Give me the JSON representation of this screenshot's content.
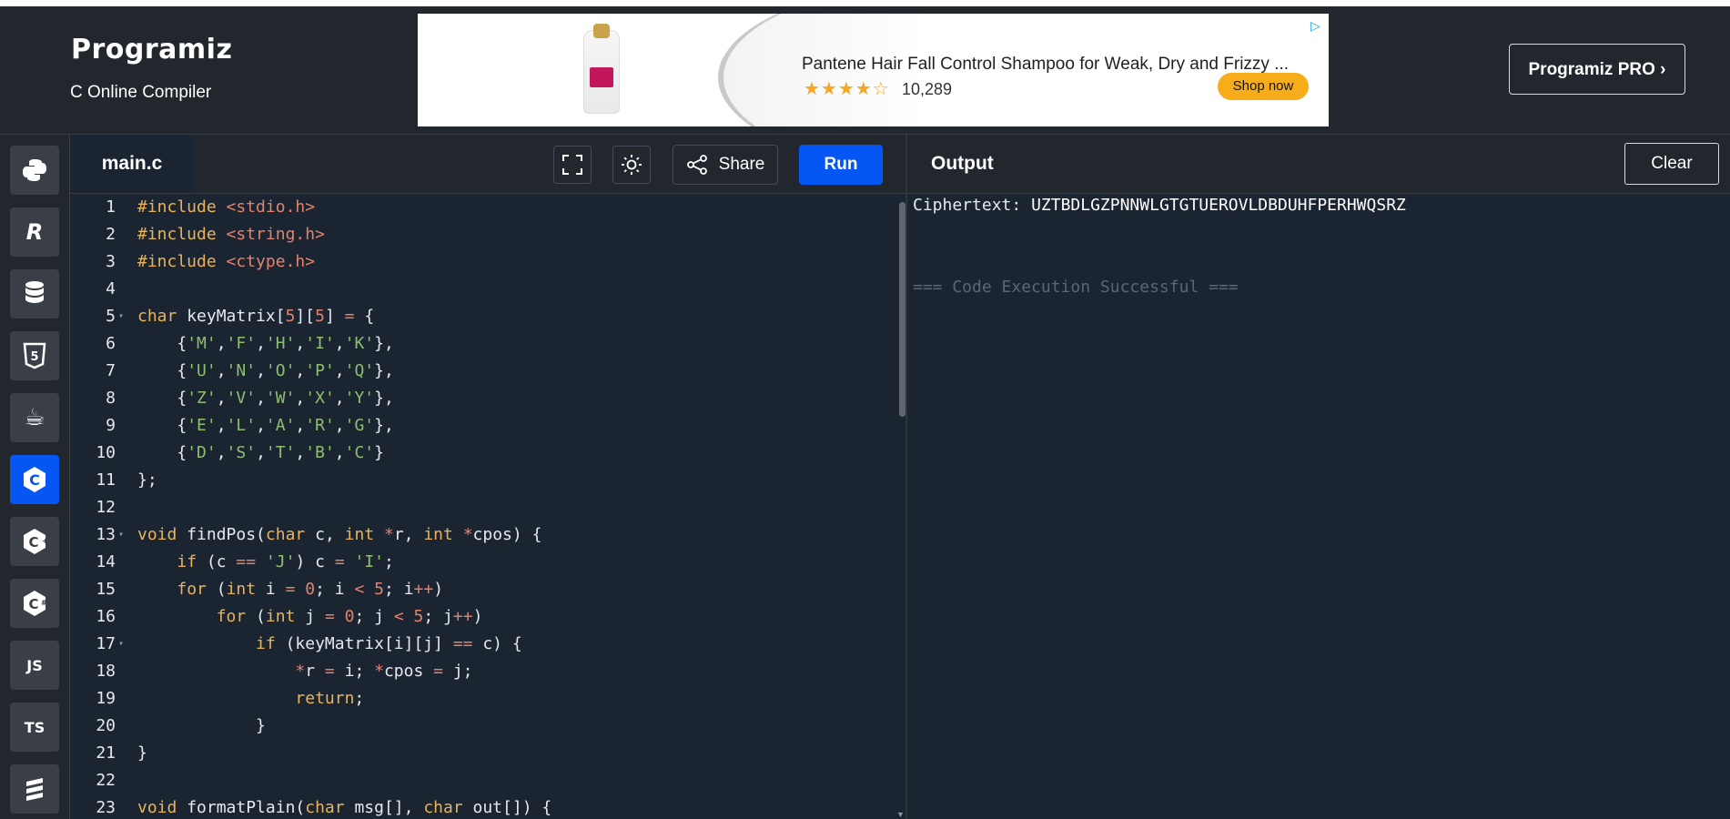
{
  "header": {
    "logo": "Programiz",
    "subtitle": "C Online Compiler",
    "pro_button": "Programiz PRO ›"
  },
  "ad": {
    "title": "Pantene Hair Fall Control Shampoo for Weak, Dry and Frizzy ...",
    "stars": "★★★★☆",
    "rating_count": "10,289",
    "cta": "Shop now"
  },
  "sidebar": {
    "items": [
      {
        "name": "python",
        "glyph": "🐍"
      },
      {
        "name": "r",
        "glyph": "R"
      },
      {
        "name": "sql",
        "glyph": "≡"
      },
      {
        "name": "html",
        "glyph": "5"
      },
      {
        "name": "java",
        "glyph": "☕"
      },
      {
        "name": "c",
        "glyph": "C",
        "active": true
      },
      {
        "name": "cpp",
        "glyph": "C"
      },
      {
        "name": "csharp",
        "glyph": "C"
      },
      {
        "name": "js",
        "glyph": "JS"
      },
      {
        "name": "ts",
        "glyph": "TS"
      },
      {
        "name": "more",
        "glyph": "≣"
      }
    ]
  },
  "editor": {
    "tab": "main.c",
    "share_label": "Share",
    "run_label": "Run",
    "lines": [
      {
        "n": "1",
        "html": "<span class='kw'>#include</span> <span class='str'>&lt;stdio.h&gt;</span>"
      },
      {
        "n": "2",
        "html": "<span class='kw'>#include</span> <span class='str'>&lt;string.h&gt;</span>"
      },
      {
        "n": "3",
        "html": "<span class='kw'>#include</span> <span class='str'>&lt;ctype.h&gt;</span>"
      },
      {
        "n": "4",
        "html": ""
      },
      {
        "n": "5",
        "fold": true,
        "html": "<span class='kw'>char</span> keyMatrix[<span class='num'>5</span>][<span class='num'>5</span>] <span class='op'>=</span> {"
      },
      {
        "n": "6",
        "html": "    {<span class='chr'>'M'</span>,<span class='chr'>'F'</span>,<span class='chr'>'H'</span>,<span class='chr'>'I'</span>,<span class='chr'>'K'</span>},"
      },
      {
        "n": "7",
        "html": "    {<span class='chr'>'U'</span>,<span class='chr'>'N'</span>,<span class='chr'>'O'</span>,<span class='chr'>'P'</span>,<span class='chr'>'Q'</span>},"
      },
      {
        "n": "8",
        "html": "    {<span class='chr'>'Z'</span>,<span class='chr'>'V'</span>,<span class='chr'>'W'</span>,<span class='chr'>'X'</span>,<span class='chr'>'Y'</span>},"
      },
      {
        "n": "9",
        "html": "    {<span class='chr'>'E'</span>,<span class='chr'>'L'</span>,<span class='chr'>'A'</span>,<span class='chr'>'R'</span>,<span class='chr'>'G'</span>},"
      },
      {
        "n": "10",
        "html": "    {<span class='chr'>'D'</span>,<span class='chr'>'S'</span>,<span class='chr'>'T'</span>,<span class='chr'>'B'</span>,<span class='chr'>'C'</span>}"
      },
      {
        "n": "11",
        "html": "};"
      },
      {
        "n": "12",
        "html": ""
      },
      {
        "n": "13",
        "fold": true,
        "html": "<span class='kw'>void</span> findPos(<span class='kw'>char</span> c, <span class='kw'>int</span> <span class='op'>*</span>r, <span class='kw'>int</span> <span class='op'>*</span>cpos) {"
      },
      {
        "n": "14",
        "html": "    <span class='kw'>if</span> (c <span class='op'>==</span> <span class='chr'>'J'</span>) c <span class='op'>=</span> <span class='chr'>'I'</span>;"
      },
      {
        "n": "15",
        "html": "    <span class='kw'>for</span> (<span class='kw'>int</span> i <span class='op'>=</span> <span class='num'>0</span>; i <span class='op'>&lt;</span> <span class='num'>5</span>; i<span class='op'>++</span>)"
      },
      {
        "n": "16",
        "html": "        <span class='kw'>for</span> (<span class='kw'>int</span> j <span class='op'>=</span> <span class='num'>0</span>; j <span class='op'>&lt;</span> <span class='num'>5</span>; j<span class='op'>++</span>)"
      },
      {
        "n": "17",
        "fold": true,
        "html": "            <span class='kw'>if</span> (keyMatrix[i][j] <span class='op'>==</span> c) {"
      },
      {
        "n": "18",
        "html": "                <span class='op'>*</span>r <span class='op'>=</span> i; <span class='op'>*</span>cpos <span class='op'>=</span> j;"
      },
      {
        "n": "19",
        "html": "                <span class='kw'>return</span>;"
      },
      {
        "n": "20",
        "html": "            }"
      },
      {
        "n": "21",
        "html": "}"
      },
      {
        "n": "22",
        "html": ""
      },
      {
        "n": "23",
        "html": "<span class='kw'>void</span> formatPlain(<span class='kw'>char</span> msg[], <span class='kw'>char</span> out[]) {"
      }
    ]
  },
  "output": {
    "title": "Output",
    "clear_label": "Clear",
    "cipher_label": "Ciphertext:",
    "cipher_value": "UZTBDLGZPNNWLGTGTUEROVLDBDUHFPERHWQSRZ",
    "status": "=== Code Execution Successful ==="
  }
}
